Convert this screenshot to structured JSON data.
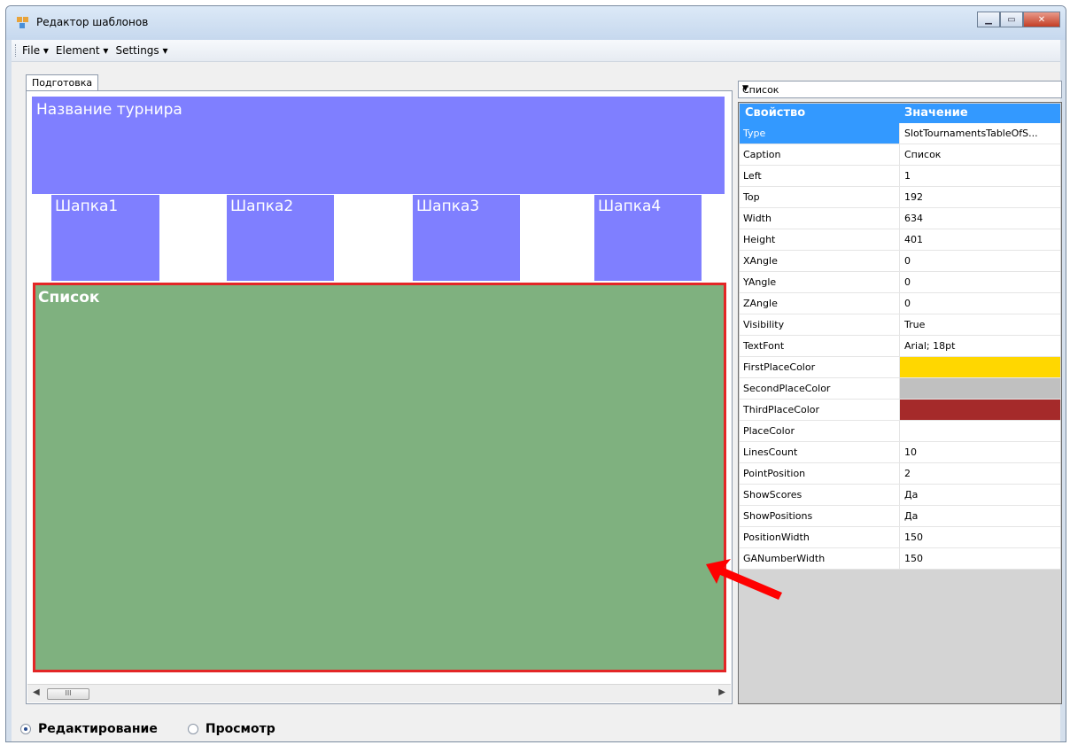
{
  "window": {
    "title": "Редактор шаблонов"
  },
  "menu": {
    "items": [
      "File ▾",
      "Element ▾",
      "Settings ▾"
    ]
  },
  "tabs": [
    "Подготовка"
  ],
  "canvas": {
    "title_block": "Название турнира",
    "headers": [
      "Шапка1",
      "Шапка2",
      "Шапка3",
      "Шапка4"
    ],
    "list_block": "Список"
  },
  "scrollbar": {
    "thumb": "III"
  },
  "object_selector": {
    "value": "Список"
  },
  "property_grid": {
    "col_property": "Свойство",
    "col_value": "Значение",
    "rows": [
      {
        "name": "Type",
        "value": "SlotTournamentsTableOfS..."
      },
      {
        "name": "Caption",
        "value": "Список"
      },
      {
        "name": "Left",
        "value": "1"
      },
      {
        "name": "Top",
        "value": "192"
      },
      {
        "name": "Width",
        "value": "634"
      },
      {
        "name": "Height",
        "value": "401"
      },
      {
        "name": "XAngle",
        "value": "0"
      },
      {
        "name": "YAngle",
        "value": "0"
      },
      {
        "name": "ZAngle",
        "value": "0"
      },
      {
        "name": "Visibility",
        "value": "True"
      },
      {
        "name": "TextFont",
        "value": "Arial; 18pt"
      },
      {
        "name": "FirstPlaceColor",
        "value": "",
        "color": "#ffd700"
      },
      {
        "name": "SecondPlaceColor",
        "value": "",
        "color": "#c0c0c0"
      },
      {
        "name": "ThirdPlaceColor",
        "value": "",
        "color": "#a52a2a"
      },
      {
        "name": "PlaceColor",
        "value": ""
      },
      {
        "name": "LinesCount",
        "value": "10"
      },
      {
        "name": "PointPosition",
        "value": "2"
      },
      {
        "name": "ShowScores",
        "value": "Да"
      },
      {
        "name": "ShowPositions",
        "value": "Да"
      },
      {
        "name": "PositionWidth",
        "value": "150"
      },
      {
        "name": "GANumberWidth",
        "value": "150"
      }
    ]
  },
  "mode": {
    "edit": "Редактирование",
    "view": "Просмотр",
    "selected": "edit"
  },
  "colors": {
    "title_block": "#7f7fff",
    "list_block": "#7fb17f",
    "list_border": "#e32626",
    "selection": "#3399ff"
  }
}
